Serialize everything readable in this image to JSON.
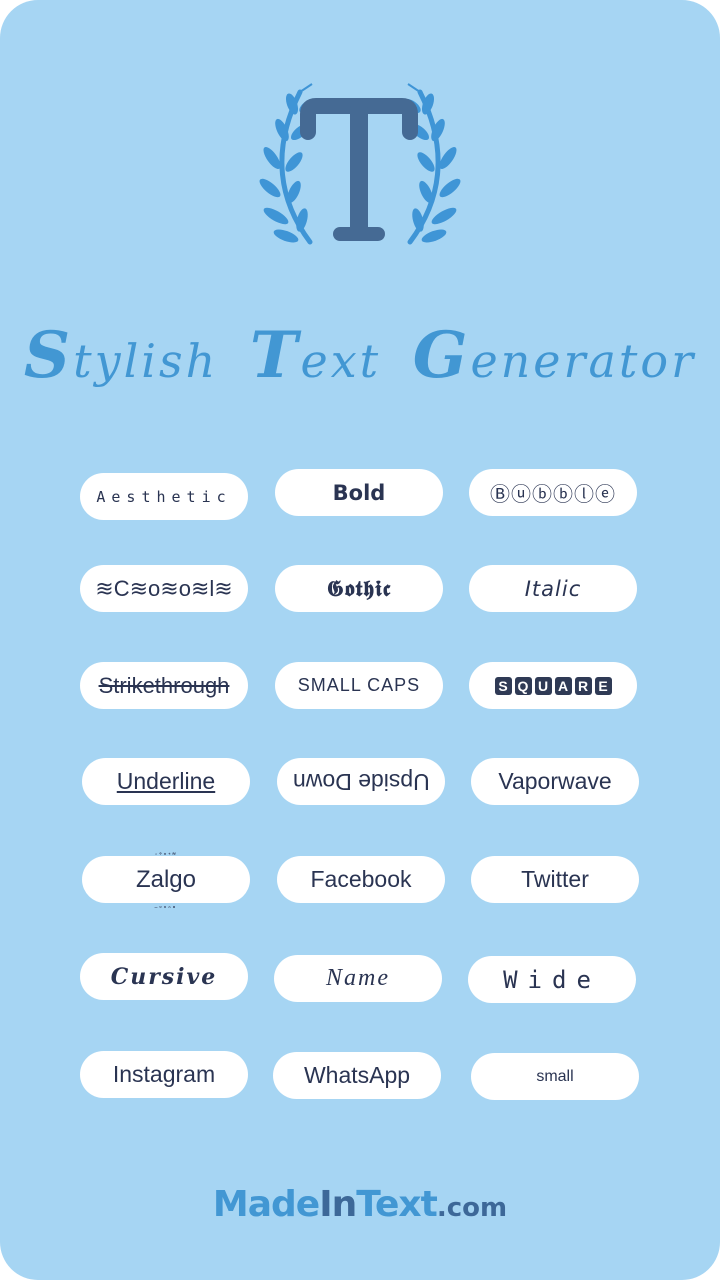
{
  "app": {
    "title_parts": [
      {
        "cap": "S",
        "rest": "tylish"
      },
      {
        "cap": "T",
        "rest": "ext"
      },
      {
        "cap": "G",
        "rest": "enerator"
      }
    ],
    "logo_icon": "letter-t-with-laurel-icon"
  },
  "colors": {
    "background": "#a6d5f3",
    "accent": "#4297d3",
    "accent_dark": "#3d6898",
    "logo_letter": "#456a94",
    "button_bg": "#ffffff",
    "button_text": "#2a3452"
  },
  "buttons": [
    {
      "id": "aesthetic",
      "label": "Aesthetic"
    },
    {
      "id": "bold",
      "label": "Bold"
    },
    {
      "id": "bubble",
      "label": "Ⓑⓤⓑⓑⓛⓔ"
    },
    {
      "id": "wavy",
      "label": "≋C≋o≋o≋l≋"
    },
    {
      "id": "gothic",
      "label": "𝕲𝖔𝖙𝖍𝖎𝖈"
    },
    {
      "id": "italic",
      "label": "Italic"
    },
    {
      "id": "strikethrough",
      "label": "Strikethrough"
    },
    {
      "id": "small-caps",
      "label": "SMALL CAPS"
    },
    {
      "id": "square",
      "label": "SQUARE",
      "letters": [
        "S",
        "Q",
        "U",
        "A",
        "R",
        "E"
      ]
    },
    {
      "id": "underline",
      "label": "Underline"
    },
    {
      "id": "upside-down",
      "label": "Upside Down"
    },
    {
      "id": "vaporwave",
      "label": "Vaporwave"
    },
    {
      "id": "zalgo",
      "label": "Zalgo",
      "marks_top": "͗ ͒ ̽ ͛ ͌",
      "marks_bottom": "̤ ̼ ͓ ̯ ̻"
    },
    {
      "id": "facebook",
      "label": "Facebook"
    },
    {
      "id": "twitter",
      "label": "Twitter"
    },
    {
      "id": "cursive",
      "label": "Cursive"
    },
    {
      "id": "name",
      "label": "Name"
    },
    {
      "id": "wide",
      "label": "Wide"
    },
    {
      "id": "instagram",
      "label": "Instagram"
    },
    {
      "id": "whatsapp",
      "label": "WhatsApp"
    },
    {
      "id": "small",
      "label": "small"
    }
  ],
  "footer": {
    "part1": "Made",
    "part2": "In",
    "part3": "Text",
    "part4": ".com"
  }
}
